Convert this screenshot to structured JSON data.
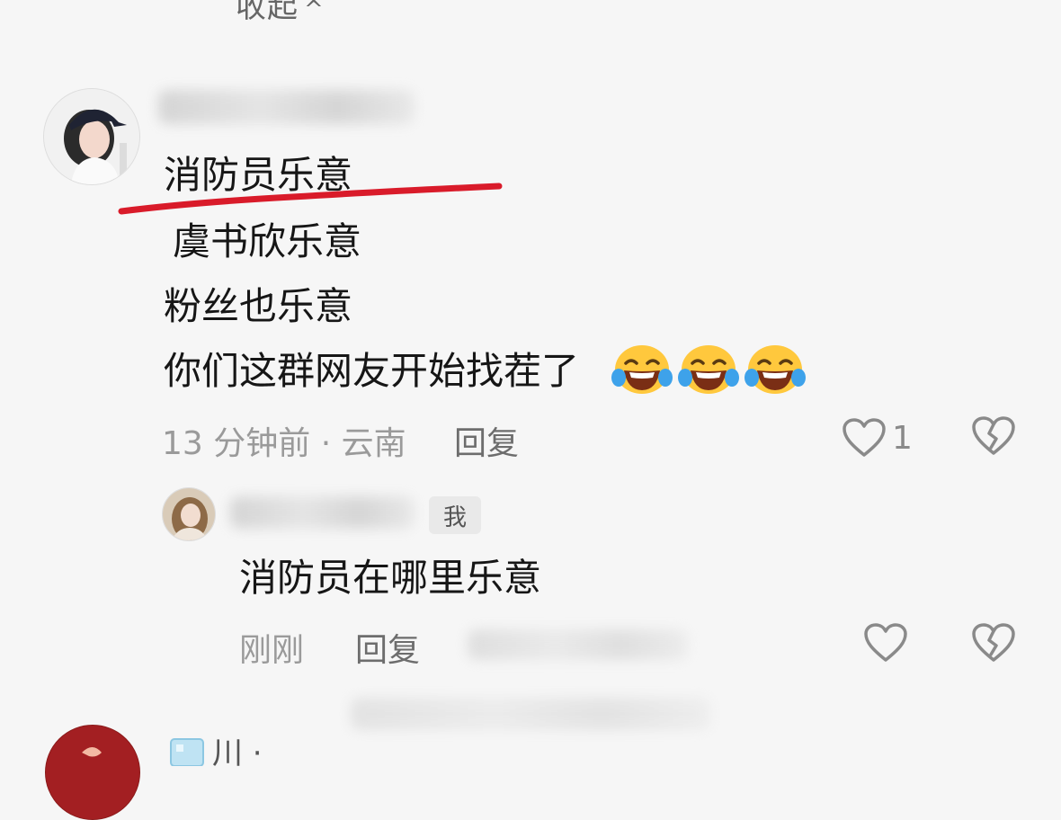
{
  "collapse": {
    "label": "收起",
    "chevron": "^"
  },
  "comment": {
    "lines": [
      "消防员乐意",
      "虞书欣乐意",
      "粉丝也乐意",
      "你们这群网友开始找茬了"
    ],
    "emojis": [
      "laughing-tears-emoji",
      "laughing-tears-emoji",
      "laughing-tears-emoji"
    ],
    "time_location": "13 分钟前 · 云南",
    "reply_label": "回复",
    "like_count": "1",
    "underline_color": "#d91b2a"
  },
  "reply": {
    "me_tag": "我",
    "text": "消防员在哪里乐意",
    "time": "刚刚",
    "reply_label": "回复"
  },
  "next_comment": {
    "name_partial": "川 ·"
  }
}
